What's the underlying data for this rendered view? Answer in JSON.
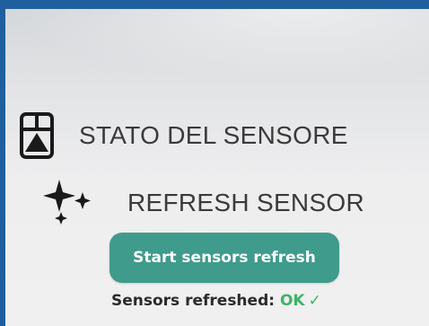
{
  "status_section": {
    "label": "STATO DEL SENSORE",
    "icon": "sensor-status-icon"
  },
  "refresh_section": {
    "label": "REFRESH SENSOR",
    "icon": "sparkles-icon"
  },
  "refresh_button": {
    "label": "Start sensors refresh"
  },
  "result": {
    "prefix": "Sensors refreshed: ",
    "status": "OK",
    "check_glyph": "✓"
  },
  "colors": {
    "button": "#3f9b8c",
    "ok": "#3fb368",
    "frame": "#1f5f9e"
  }
}
